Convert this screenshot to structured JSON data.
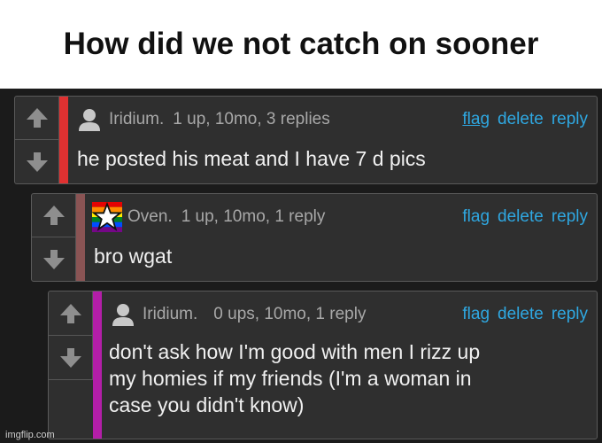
{
  "meme_title": "How did we not catch on sooner",
  "watermark": "imgflip.com",
  "colors": {
    "background": "#1b1b1b",
    "panel": "#2f2f2f",
    "link": "#2fa8e2",
    "stripe_1": "#e03131",
    "stripe_2": "#8a5454",
    "stripe_3": "#b31ea8"
  },
  "comments": [
    {
      "username": "Iridium.",
      "avatar": "person-icon",
      "meta": "1 up, 10mo, 3 replies",
      "actions": {
        "flag": "flag",
        "delete": "delete",
        "reply": "reply"
      },
      "text": "he posted his meat and I have 7 d pics"
    },
    {
      "username": "Oven.",
      "avatar": "rainbow-star-icon",
      "meta": "1 up, 10mo, 1 reply",
      "actions": {
        "flag": "flag",
        "delete": "delete",
        "reply": "reply"
      },
      "text": "bro wgat"
    },
    {
      "username": "Iridium.",
      "avatar": "person-icon",
      "meta": "0 ups, 10mo, 1 reply",
      "actions": {
        "flag": "flag",
        "delete": "delete",
        "reply": "reply"
      },
      "text": "don't ask how I'm good with men I rizz up\nmy homies if my friends (I'm a woman in\ncase you didn't know)"
    }
  ]
}
